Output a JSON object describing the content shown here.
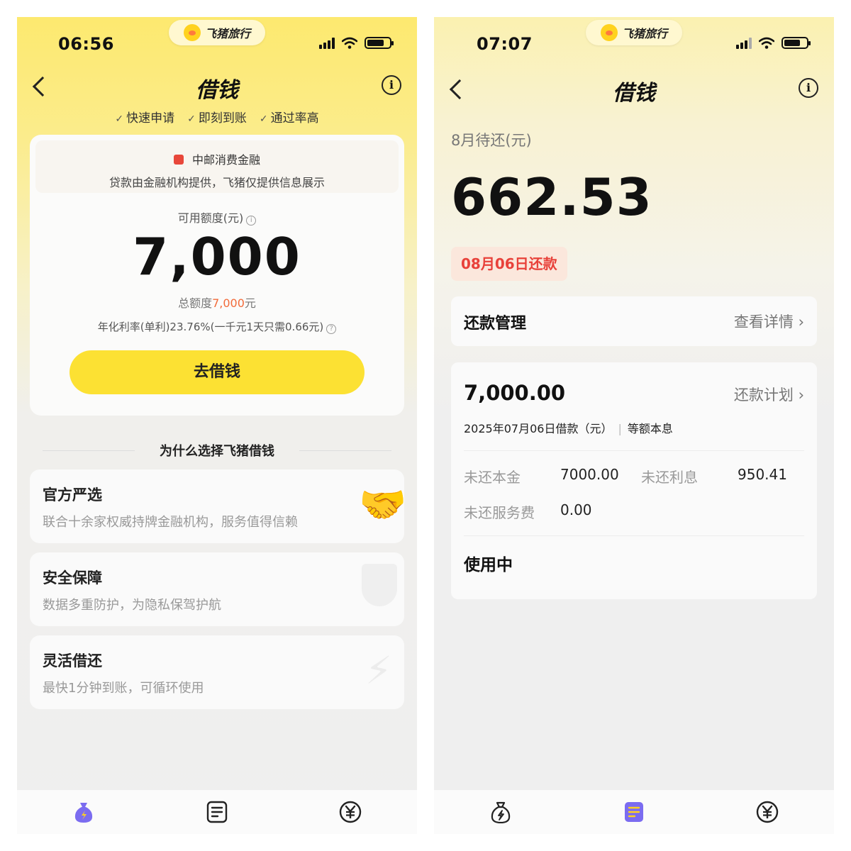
{
  "brand": {
    "name": "飞猪旅行"
  },
  "left": {
    "status": {
      "time": "06:56"
    },
    "nav": {
      "title": "借钱"
    },
    "features": [
      "快速申请",
      "即刻到账",
      "通过率高"
    ],
    "institution": {
      "name": "中邮消费金融",
      "note": "贷款由金融机构提供，飞猪仅提供信息展示"
    },
    "credit": {
      "label": "可用额度(元)",
      "value": "7,000",
      "total_prefix": "总额度",
      "total_value": "7,000",
      "total_suffix": "元",
      "rate_text": "年化利率(单利)23.76%(一千元1天只需0.66元)"
    },
    "cta_label": "去借钱",
    "why_title": "为什么选择飞猪借钱",
    "cards": [
      {
        "title": "官方严选",
        "desc": "联合十余家权威持牌金融机构，服务值得信赖"
      },
      {
        "title": "安全保障",
        "desc": "数据多重防护，为隐私保驾护航"
      },
      {
        "title": "灵活借还",
        "desc": "最快1分钟到账，可循环使用"
      }
    ]
  },
  "right": {
    "status": {
      "time": "07:07"
    },
    "nav": {
      "title": "借钱"
    },
    "due_label": "8月待还(元)",
    "due_amount": "662.53",
    "due_date_tag": "08月06日还款",
    "management": {
      "title": "还款管理",
      "link": "查看详情"
    },
    "loan": {
      "amount": "7,000.00",
      "link": "还款计划",
      "subtitle": "2025年07月06日借款（元）",
      "method": "等额本息",
      "principal_label": "未还本金",
      "principal_value": "7000.00",
      "interest_label": "未还利息",
      "interest_value": "950.41",
      "fee_label": "未还服务费",
      "fee_value": "0.00",
      "status": "使用中"
    }
  },
  "colors": {
    "accent_yellow": "#fce133",
    "accent_orange": "#f26b3a",
    "due_red": "#e8413a",
    "active_tab": "#7b6cf0"
  },
  "icons": [
    "chevron-left-icon",
    "info-icon",
    "check-icon",
    "wifi-icon",
    "signal-icon",
    "battery-icon",
    "money-bag-icon",
    "document-icon",
    "yen-icon",
    "handshake-icon",
    "shield-icon",
    "lightning-icon"
  ]
}
